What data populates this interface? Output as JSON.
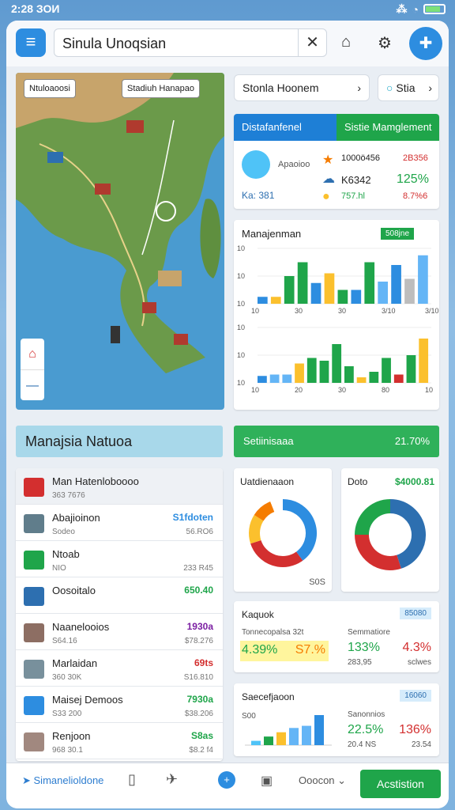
{
  "status": {
    "time": "2:28 ЗОИ"
  },
  "search": {
    "value": "Sinula Unoqsian"
  },
  "icons": {
    "menu": "menu-icon",
    "close": "close-icon",
    "home": "home-icon",
    "settings": "gear-icon",
    "fab": "plus-icon"
  },
  "map": {
    "chip1": "Ntuloaoosi",
    "chip2": "Stadiuh Hanapao"
  },
  "select_pills": {
    "primary": "Stonla Hoonem",
    "secondary": "Stia"
  },
  "mgmt_card": {
    "tab1": "Distafanfenel",
    "tab2": "Sistie Mamglement",
    "caption": "Apaoioo",
    "user": "Ka: 381",
    "n1": "1000ö456",
    "n1r": "2B356",
    "n2": "K6342",
    "n2r": "125%",
    "n3": "757.hl",
    "n3r": "8.7%6",
    "color_red": "#d32f2f",
    "color_green": "#1fa54a"
  },
  "bar_card": {
    "title": "Manajenman",
    "badge": "508jne",
    "chart_data": [
      {
        "type": "bar",
        "ylim": [
          0,
          40
        ],
        "yticks": [
          "10",
          "10",
          "10"
        ],
        "xticks": [
          "10",
          "30",
          "30",
          "3/10",
          "3/10"
        ],
        "values": [
          5,
          5,
          20,
          30,
          15,
          22,
          10,
          10,
          30,
          16,
          28,
          18,
          35
        ],
        "colors": [
          "#2d8de0",
          "#fbc02d",
          "#1fa54a",
          "#1fa54a",
          "#2d8de0",
          "#fbc02d",
          "#1fa54a",
          "#2d8de0",
          "#1fa54a",
          "#64b5f6",
          "#2d8de0",
          "#bdbdbd",
          "#64b5f6"
        ]
      },
      {
        "type": "bar",
        "ylim": [
          0,
          40
        ],
        "yticks": [
          "10",
          "10",
          "10"
        ],
        "xticks": [
          "10",
          "20",
          "30",
          "80",
          "10"
        ],
        "values": [
          5,
          6,
          6,
          14,
          18,
          16,
          28,
          12,
          4,
          8,
          18,
          6,
          20,
          32
        ],
        "colors": [
          "#2d8de0",
          "#64b5f6",
          "#64b5f6",
          "#fbc02d",
          "#1fa54a",
          "#1fa54a",
          "#1fa54a",
          "#1fa54a",
          "#fbc02d",
          "#1fa54a",
          "#1fa54a",
          "#d32f2f",
          "#1fa54a",
          "#fbc02d"
        ]
      }
    ]
  },
  "section_left": {
    "title": "Manajsia Natuoa"
  },
  "section_right": {
    "title": "Setiinisaaa",
    "value": "21.70%"
  },
  "list": [
    {
      "name": "Man Hatenloboooo",
      "sub": "363 7676",
      "v1": "",
      "v2": "",
      "color": "#d32f2f",
      "v1color": "#333"
    },
    {
      "name": "Abajioinon",
      "sub": "Sodeo",
      "v1": "S1fdoten",
      "v2": "56.RO6",
      "color": "#607d8b",
      "v1color": "#2d8de0"
    },
    {
      "name": "Ntoab",
      "sub": "NIO",
      "v1": "",
      "v2": "233 R45",
      "color": "#1fa54a",
      "v1color": "#1fa54a"
    },
    {
      "name": "Oosoitalo",
      "sub": "",
      "v1": "650.40",
      "v2": "",
      "color": "#2d6fb0",
      "v1color": "#1fa54a"
    },
    {
      "name": "Naanelooios",
      "sub": "S64.16",
      "v1": "1930a",
      "v2": "$78.276",
      "color": "#8d6e63",
      "v1color": "#7b1fa2"
    },
    {
      "name": "Marlaidan",
      "sub": "360 30K",
      "v1": "69ts",
      "v2": "S16.810",
      "color": "#78909c",
      "v1color": "#d32f2f"
    },
    {
      "name": "Maisej Demoos",
      "sub": "S33 200",
      "v1": "7930a",
      "v2": "$38.206",
      "color": "#2d8de0",
      "v1color": "#1fa54a"
    },
    {
      "name": "Renjoon",
      "sub": "968 30.1",
      "v1": "S8as",
      "v2": "$8.2 f4",
      "color": "#a1887f",
      "v1color": "#1fa54a"
    }
  ],
  "donut1": {
    "title": "Uatdienaaon",
    "foot": "S0S",
    "chart_data": {
      "type": "pie",
      "values": [
        40,
        30,
        14,
        10,
        6
      ],
      "colors": [
        "#2d8de0",
        "#d32f2f",
        "#fbc02d",
        "#f57c00",
        "#ffffff"
      ]
    }
  },
  "donut2": {
    "title": "Doto",
    "value": "$4000.81",
    "chart_data": {
      "type": "pie",
      "values": [
        45,
        30,
        25
      ],
      "colors": [
        "#2d6fb0",
        "#d32f2f",
        "#1fa54a"
      ]
    }
  },
  "kpi1": {
    "title": "Kaquok",
    "badge": "85080",
    "sub": "Tonnecopalsa 32t",
    "a": "4.39%",
    "b": "S7.%",
    "c_label": "Semmatiore",
    "c": "133%",
    "c2": "283,95",
    "d": "4.3%",
    "d2": "sclwes"
  },
  "kpi2": {
    "title": "Saecefjaoon",
    "badge": "16060",
    "y": "S00",
    "c_label": "Sanonnios",
    "c": "22.5%",
    "c2": "20.4 NS",
    "d": "136%",
    "d2": "23.54",
    "chart_data": {
      "type": "bar",
      "values": [
        2,
        4,
        6,
        8,
        9,
        14
      ],
      "colors": [
        "#4fc3f7",
        "#1fa54a",
        "#fbc02d",
        "#64b5f6",
        "#64b5f6",
        "#2d8de0"
      ]
    }
  },
  "bottom": {
    "nav1": "Simanelioldone",
    "nav2": "",
    "nav3": "",
    "nav4": "",
    "dropdown": "Ooocon",
    "action": "Acstistion"
  }
}
